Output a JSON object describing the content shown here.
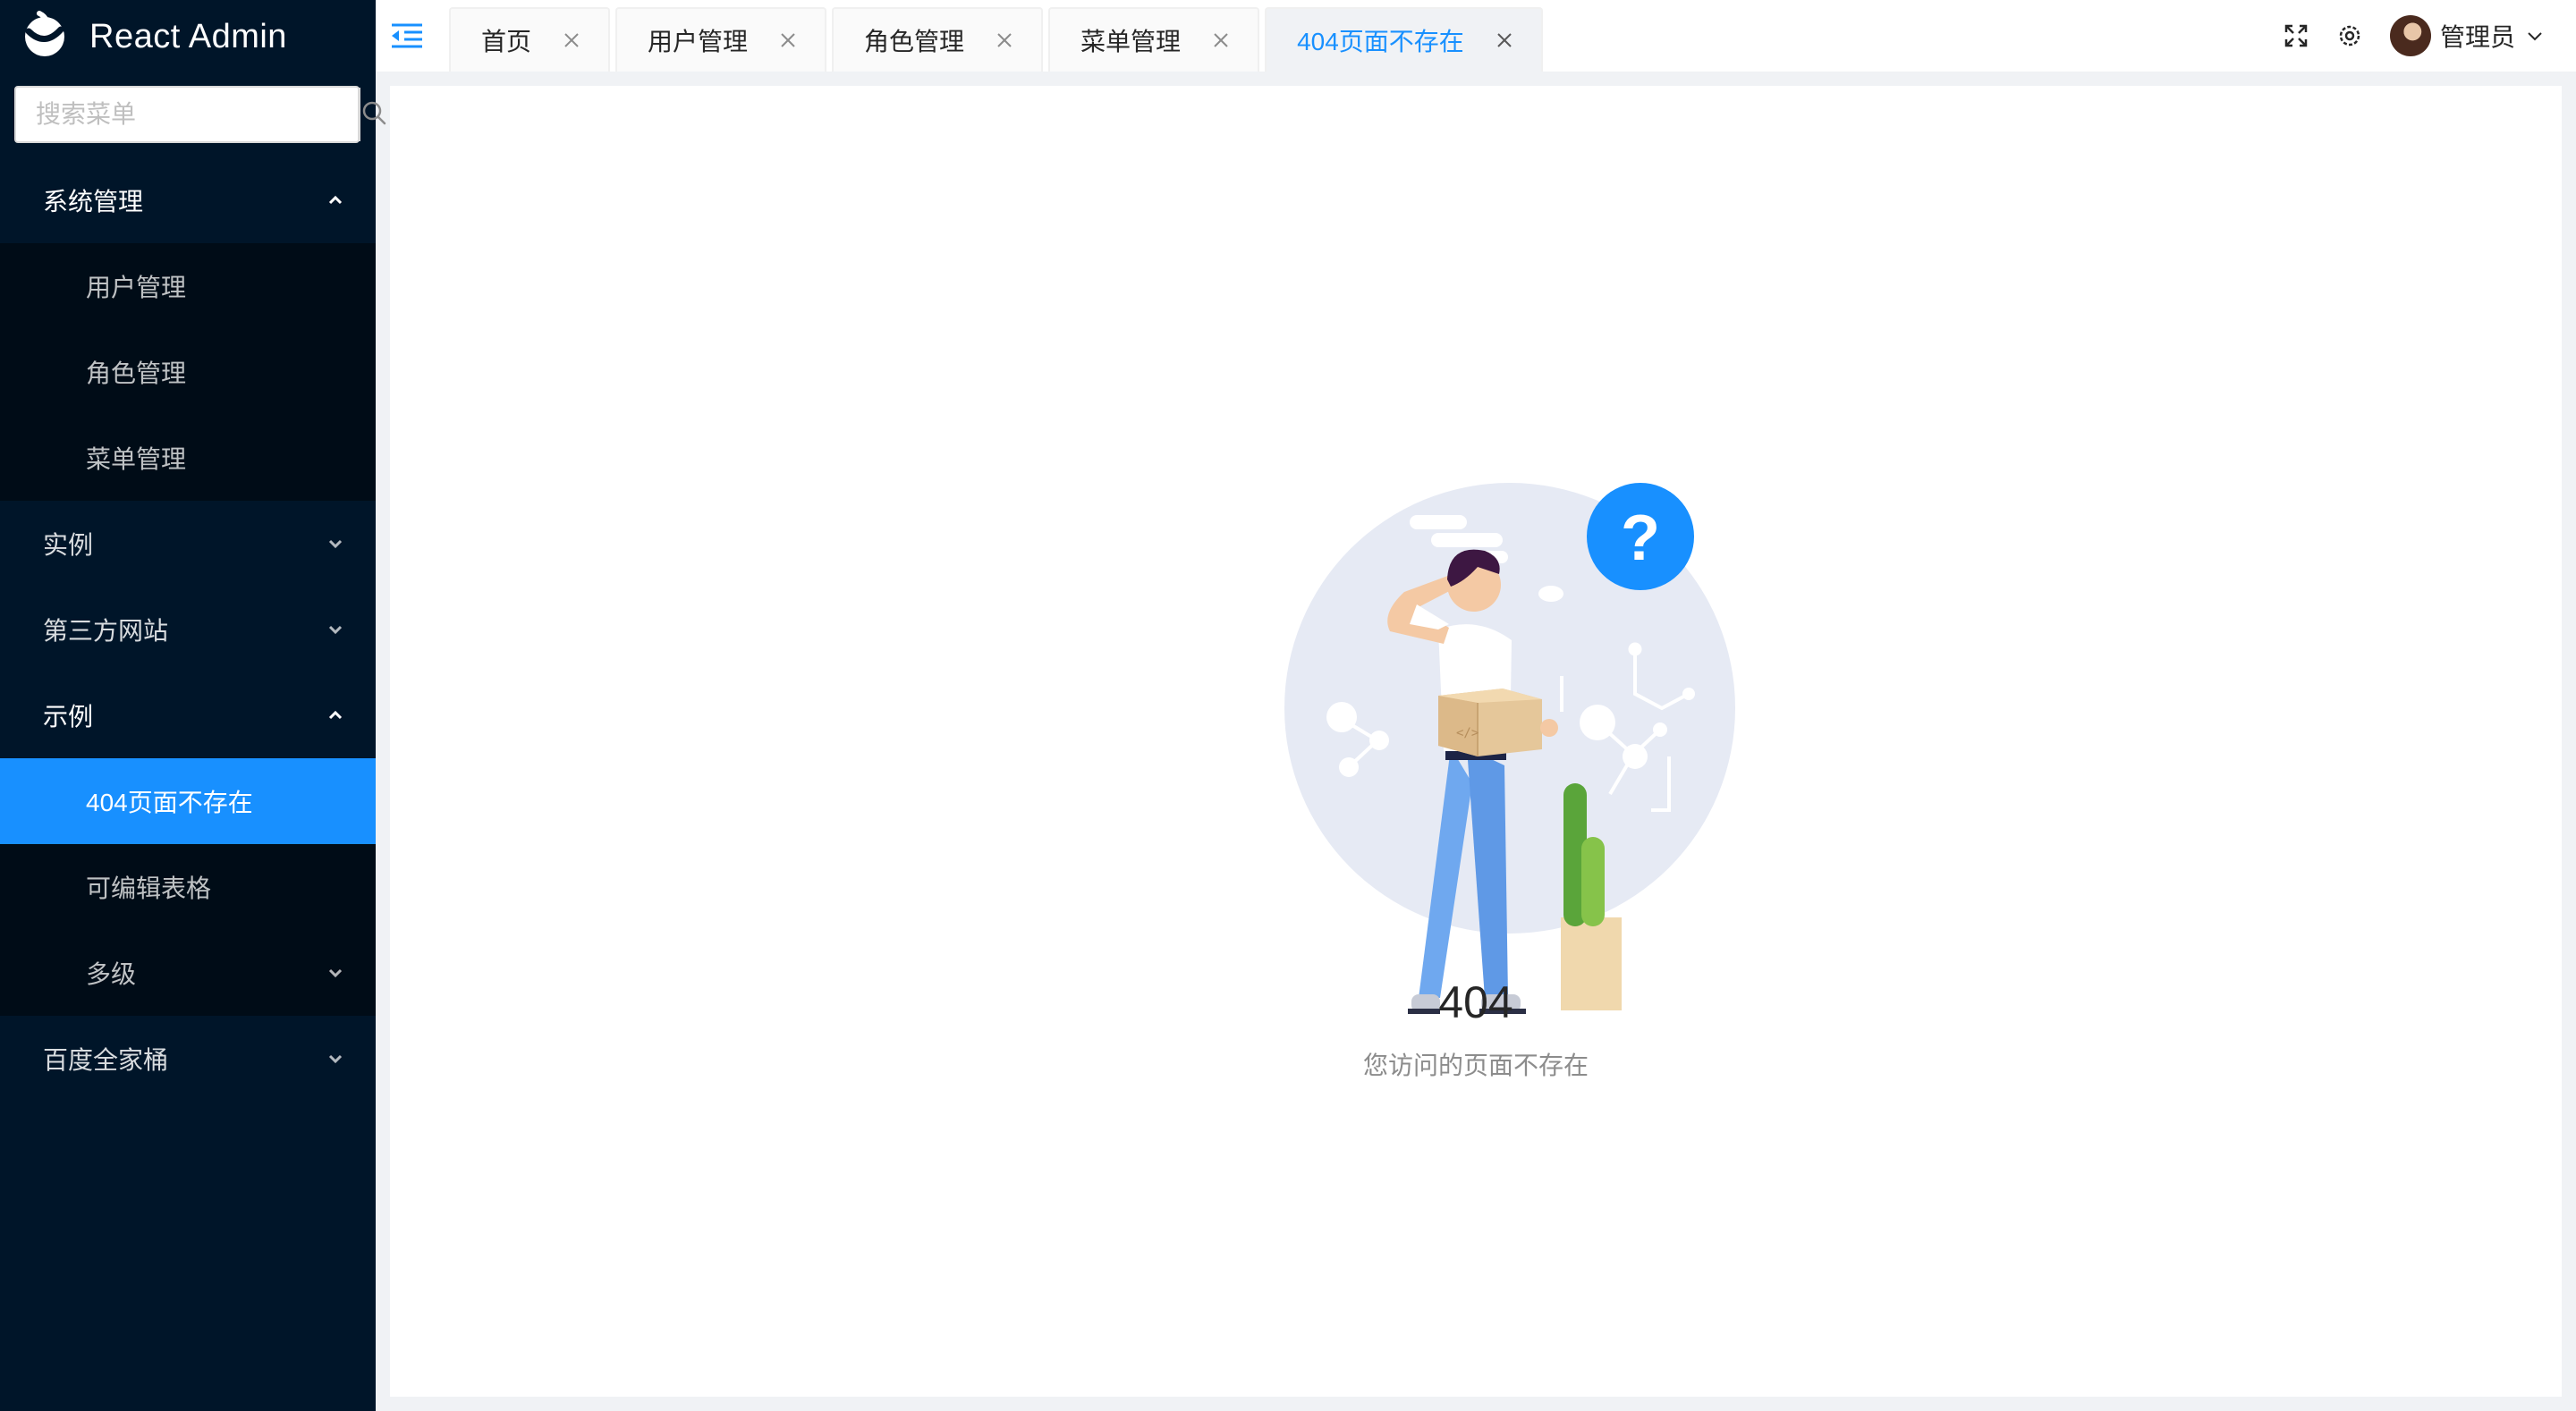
{
  "app": {
    "title": "React Admin"
  },
  "search": {
    "placeholder": "搜索菜单",
    "value": ""
  },
  "menu": {
    "system": {
      "label": "系统管理",
      "items": [
        {
          "label": "用户管理"
        },
        {
          "label": "角色管理"
        },
        {
          "label": "菜单管理"
        }
      ]
    },
    "instance": {
      "label": "实例"
    },
    "third_party": {
      "label": "第三方网站"
    },
    "examples": {
      "label": "示例",
      "items": [
        {
          "label": "404页面不存在",
          "active": true
        },
        {
          "label": "可编辑表格"
        },
        {
          "label": "多级"
        }
      ]
    },
    "baidu": {
      "label": "百度全家桶"
    }
  },
  "tabs": [
    {
      "label": "首页"
    },
    {
      "label": "用户管理"
    },
    {
      "label": "角色管理"
    },
    {
      "label": "菜单管理"
    },
    {
      "label": "404页面不存在",
      "active": true
    }
  ],
  "header": {
    "user_name": "管理员",
    "icons": [
      "fullscreen-icon",
      "settings-icon",
      "avatar",
      "chevron-down-icon"
    ]
  },
  "result": {
    "code": "404",
    "message": "您访问的页面不存在"
  },
  "colors": {
    "sidebar_bg": "#001529",
    "submenu_bg": "#000c17",
    "accent": "#1890ff",
    "content_bg": "#f0f2f5"
  }
}
